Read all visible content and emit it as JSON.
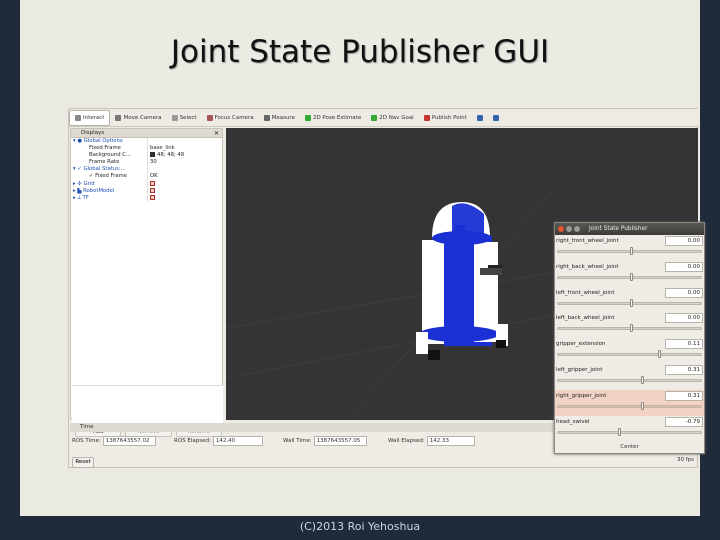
{
  "slide_title": "Joint State Publisher GUI",
  "footer": "(C)2013 Roi Yehoshua",
  "toolbar": [
    {
      "label": "Interact",
      "icon": "hand-icon",
      "active": true
    },
    {
      "label": "Move Camera",
      "icon": "move-camera-icon"
    },
    {
      "label": "Select",
      "icon": "select-icon"
    },
    {
      "label": "Focus Camera",
      "icon": "focus-camera-icon"
    },
    {
      "label": "Measure",
      "icon": "measure-icon"
    },
    {
      "label": "2D Pose Estimate",
      "icon": "pose-estimate-arrow-icon"
    },
    {
      "label": "2D Nav Goal",
      "icon": "nav-goal-arrow-icon"
    },
    {
      "label": "Publish Point",
      "icon": "publish-point-icon"
    },
    {
      "label": "",
      "icon": "plus-icon"
    },
    {
      "label": "",
      "icon": "minus-icon"
    }
  ],
  "displays": {
    "title": "Displays",
    "rows": [
      {
        "key": "▾ ● Global Options",
        "value": "",
        "blue": true,
        "indent": 0
      },
      {
        "key": "Fixed Frame",
        "value": "base_link",
        "indent": 2
      },
      {
        "key": "Background C...",
        "value": "48; 48; 48",
        "swatch": "#303030",
        "indent": 2
      },
      {
        "key": "Frame Rate",
        "value": "30",
        "indent": 2
      },
      {
        "key": "▾ ✓ Global Status:...",
        "value": "",
        "blue": true,
        "indent": 0
      },
      {
        "key": "✓ Fixed Frame",
        "value": "OK",
        "indent": 2
      },
      {
        "key": "▸ ✣ Grid",
        "value": "",
        "blue": true,
        "check": true,
        "indent": 0
      },
      {
        "key": "▸ ▙ RobotModel",
        "value": "",
        "blue": true,
        "check": true,
        "indent": 0
      },
      {
        "key": "▸ ⟂ TF",
        "value": "",
        "blue": true,
        "check": true,
        "indent": 0
      }
    ],
    "buttons": {
      "add": "Add",
      "remove": "Remove",
      "rename": "Rename"
    }
  },
  "time": {
    "title": "Time",
    "ros_time_label": "ROS Time:",
    "ros_time": "1387643557.02",
    "ros_elapsed_label": "ROS Elapsed:",
    "ros_elapsed": "142.40",
    "wall_time_label": "Wall Time:",
    "wall_time": "1387643557.05",
    "wall_elapsed_label": "Wall Elapsed:",
    "wall_elapsed": "142.33",
    "reset": "Reset",
    "fps": "30 fps"
  },
  "jsp": {
    "title": "Joint State Publisher",
    "center": "Center",
    "joints": [
      {
        "name": "right_front_wheel_joint",
        "value": "0.00",
        "pos": 0.5
      },
      {
        "name": "right_back_wheel_joint",
        "value": "0.00",
        "pos": 0.5
      },
      {
        "name": "left_front_wheel_joint",
        "value": "0.00",
        "pos": 0.5
      },
      {
        "name": "left_back_wheel_joint",
        "value": "0.00",
        "pos": 0.5
      },
      {
        "name": "gripper_extension",
        "value": "0.11",
        "pos": 0.7
      },
      {
        "name": "left_gripper_joint",
        "value": "0.31",
        "pos": 0.58
      },
      {
        "name": "right_gripper_joint",
        "value": "0.31",
        "pos": 0.58,
        "highlight": true
      },
      {
        "name": "head_swivel",
        "value": "-0.79",
        "pos": 0.42
      }
    ]
  }
}
